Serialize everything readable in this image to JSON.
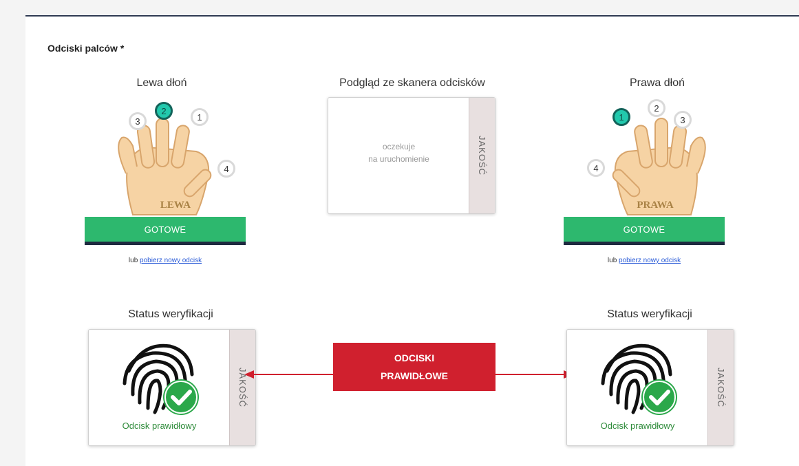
{
  "section": {
    "title": "Odciski palców *"
  },
  "left_hand": {
    "title": "Lewa dłoń",
    "palm_label": "LEWA",
    "fingers": [
      "3",
      "2",
      "1",
      "4"
    ],
    "active_finger": "2",
    "ready_label": "GOTOWE",
    "alt_prefix": "lub",
    "alt_link": "pobierz nowy odcisk"
  },
  "preview": {
    "title": "Podgląd ze skanera odcisków",
    "line1": "oczekuje",
    "line2": "na uruchomienie",
    "quality_label": "JAKOŚĆ"
  },
  "right_hand": {
    "title": "Prawa dłoń",
    "palm_label": "PRAWA",
    "fingers": [
      "1",
      "2",
      "3",
      "4"
    ],
    "active_finger": "1",
    "ready_label": "GOTOWE",
    "alt_prefix": "lub",
    "alt_link": "pobierz nowy odcisk"
  },
  "status_left": {
    "title": "Status weryfikacji",
    "result": "Odcisk prawidłowy",
    "quality_label": "JAKOŚĆ"
  },
  "status_right": {
    "title": "Status weryfikacji",
    "result": "Odcisk prawidłowy",
    "quality_label": "JAKOŚĆ"
  },
  "banner": {
    "line1": "ODCISKI",
    "line2": "PRAWIDŁOWE"
  },
  "colors": {
    "accent_teal": "#22c9ad",
    "ready_green": "#2db86e",
    "ok_green": "#2e8b3a",
    "banner_red": "#d0202e",
    "skin": "#f6d3a4"
  }
}
